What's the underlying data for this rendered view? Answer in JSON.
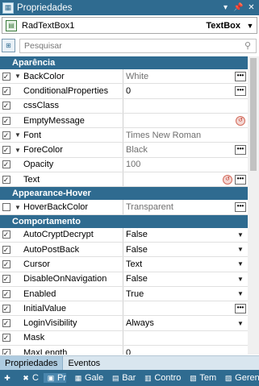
{
  "window": {
    "title": "Propriedades",
    "pin_icon": "pin-icon",
    "close_icon": "close-icon"
  },
  "object_selector": {
    "name": "RadTextBox1",
    "type": "TextBox"
  },
  "search": {
    "placeholder": "Pesquisar"
  },
  "categories": [
    {
      "label": "Aparência",
      "rows": [
        {
          "name": "BackColor",
          "value": "White",
          "checked": true,
          "expand": true,
          "gray": true,
          "button": "ellipsis"
        },
        {
          "name": "ConditionalProperties",
          "value": "0",
          "checked": true,
          "button": "ellipsis"
        },
        {
          "name": "cssClass",
          "value": "",
          "checked": true
        },
        {
          "name": "EmptyMessage",
          "value": "",
          "checked": true,
          "button": "reset"
        },
        {
          "name": "Font",
          "value": "Times New Roman",
          "checked": true,
          "expand": true,
          "gray": true
        },
        {
          "name": "ForeColor",
          "value": "Black",
          "checked": true,
          "expand": true,
          "gray": true,
          "button": "ellipsis"
        },
        {
          "name": "Opacity",
          "value": "100",
          "checked": true,
          "gray": true
        },
        {
          "name": "Text",
          "value": "",
          "checked": true,
          "button": "reset-ellipsis"
        }
      ]
    },
    {
      "label": "Appearance-Hover",
      "rows": [
        {
          "name": "HoverBackColor",
          "value": "Transparent",
          "checked": false,
          "expand": true,
          "gray": true,
          "button": "ellipsis"
        }
      ]
    },
    {
      "label": "Comportamento",
      "rows": [
        {
          "name": "AutoCryptDecrypt",
          "value": "False",
          "checked": true,
          "button": "dropdown"
        },
        {
          "name": "AutoPostBack",
          "value": "False",
          "checked": true,
          "button": "dropdown"
        },
        {
          "name": "Cursor",
          "value": "Text",
          "checked": true,
          "button": "dropdown"
        },
        {
          "name": "DisableOnNavigation",
          "value": "False",
          "checked": true,
          "button": "dropdown"
        },
        {
          "name": "Enabled",
          "value": "True",
          "checked": true,
          "button": "dropdown"
        },
        {
          "name": "InitialValue",
          "value": "",
          "checked": true,
          "button": "ellipsis"
        },
        {
          "name": "LoginVisibility",
          "value": "Always",
          "checked": true,
          "button": "dropdown"
        },
        {
          "name": "Mask",
          "value": "",
          "checked": true
        },
        {
          "name": "MaxLength",
          "value": "0",
          "checked": true
        }
      ]
    }
  ],
  "bottom_tabs": [
    "Propriedades",
    "Eventos"
  ],
  "taskbar": [
    {
      "icon": "add-icon",
      "label": ""
    },
    {
      "icon": "tools-icon",
      "label": "C"
    },
    {
      "icon": "properties-icon",
      "label": "Pr"
    },
    {
      "icon": "gallery-icon",
      "label": "Gale"
    },
    {
      "icon": "database-icon",
      "label": "Bar"
    },
    {
      "icon": "controls-icon",
      "label": "Contro"
    },
    {
      "icon": "templates-icon",
      "label": "Tem"
    },
    {
      "icon": "manager-icon",
      "label": "Geren"
    }
  ]
}
